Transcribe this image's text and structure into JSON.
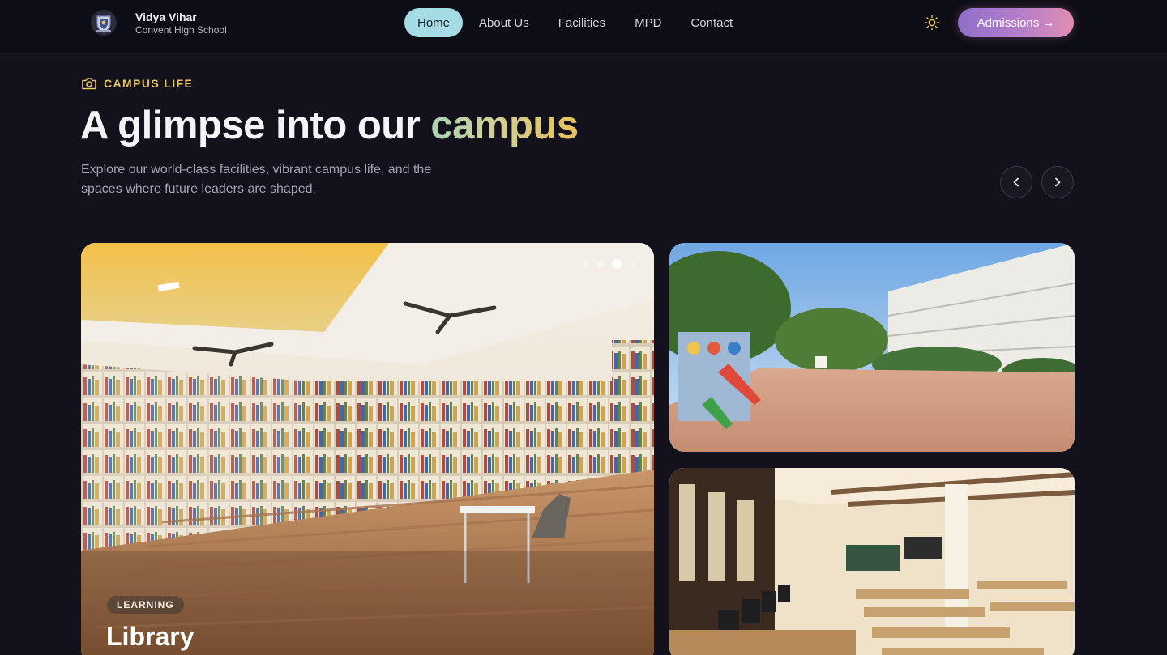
{
  "brand": {
    "name": "Vidya Vihar",
    "subtitle": "Convent High School"
  },
  "nav": {
    "links": [
      {
        "label": "Home",
        "active": true
      },
      {
        "label": "About Us",
        "active": false
      },
      {
        "label": "Facilities",
        "active": false
      },
      {
        "label": "MPD",
        "active": false
      },
      {
        "label": "Contact",
        "active": false
      }
    ],
    "theme_icon": "sun-icon",
    "cta_label": "Admissions →"
  },
  "section": {
    "eyebrow_icon": "camera-icon",
    "eyebrow": "CAMPUS LIFE",
    "title_prefix": "A glimpse into our ",
    "title_highlight": "campus",
    "subtitle": "Explore our world-class facilities, vibrant campus life, and the spaces where future leaders are shaped.",
    "prev_icon": "chevron-left-icon",
    "next_icon": "chevron-right-icon"
  },
  "gallery": {
    "featured": {
      "badge": "LEARNING",
      "title": "Library",
      "slide_count": 4,
      "active_slide": 3
    },
    "side_photos": [
      "playground-photo",
      "classroom-photo"
    ]
  },
  "colors": {
    "background": "#13121c",
    "nav_background": "#0d0d15",
    "accent_gold": "#e8c463",
    "active_pill": "#a5dbe2",
    "cta_start": "#8f6fc8",
    "cta_end": "#e08db2"
  }
}
